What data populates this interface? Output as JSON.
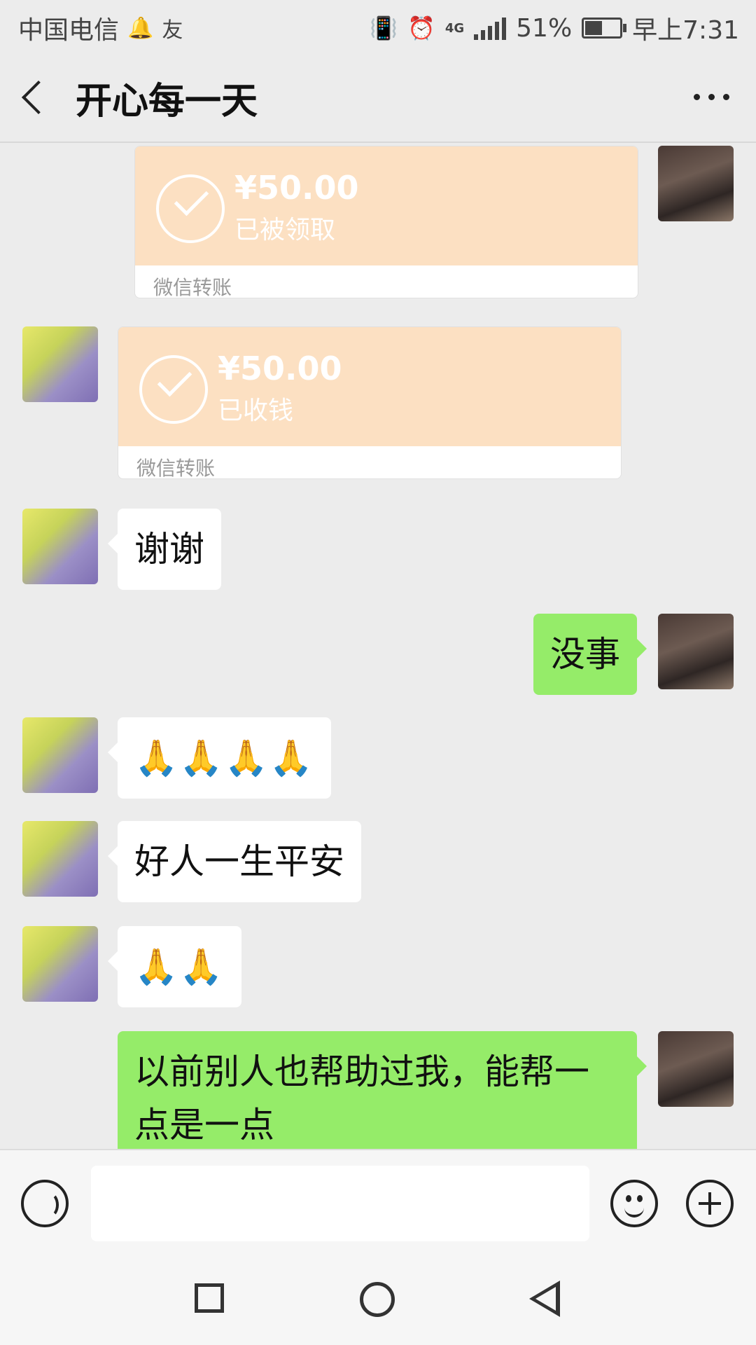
{
  "status_bar": {
    "carrier": "中国电信",
    "network": "4G",
    "battery": "51%",
    "battery_level": 0.51,
    "time": "早上7:31",
    "icons": [
      "notification-bell-icon",
      "friend-request-icon",
      "vibrate-icon",
      "alarm-icon",
      "signal-icon",
      "battery-icon"
    ]
  },
  "header": {
    "title": "开心每一天",
    "back_icon": "chevron-left-icon",
    "more_icon": "more-dots-icon"
  },
  "messages": [
    {
      "sender": "self",
      "type": "transfer",
      "amount": "¥50.00",
      "status": "已被领取",
      "label": "微信转账"
    },
    {
      "sender": "other",
      "type": "transfer",
      "amount": "¥50.00",
      "status": "已收钱",
      "label": "微信转账"
    },
    {
      "sender": "other",
      "type": "text",
      "text": "谢谢"
    },
    {
      "sender": "self",
      "type": "text",
      "text": "没事"
    },
    {
      "sender": "other",
      "type": "emoji",
      "text": "🙏🙏🙏🙏"
    },
    {
      "sender": "other",
      "type": "text",
      "text": "好人一生平安"
    },
    {
      "sender": "other",
      "type": "emoji",
      "text": "🙏🙏"
    },
    {
      "sender": "self",
      "type": "text",
      "text": "以前别人也帮助过我，能帮一点是一点"
    }
  ],
  "input_bar": {
    "placeholder": "",
    "icons": [
      "voice-icon",
      "emoji-icon",
      "plus-icon"
    ]
  },
  "nav_bar": {
    "icons": [
      "recent-apps-icon",
      "home-icon",
      "back-icon"
    ]
  },
  "colors": {
    "background": "#ececec",
    "self_bubble": "#95ec69",
    "other_bubble": "#ffffff",
    "transfer_card": "#fce0c2"
  }
}
